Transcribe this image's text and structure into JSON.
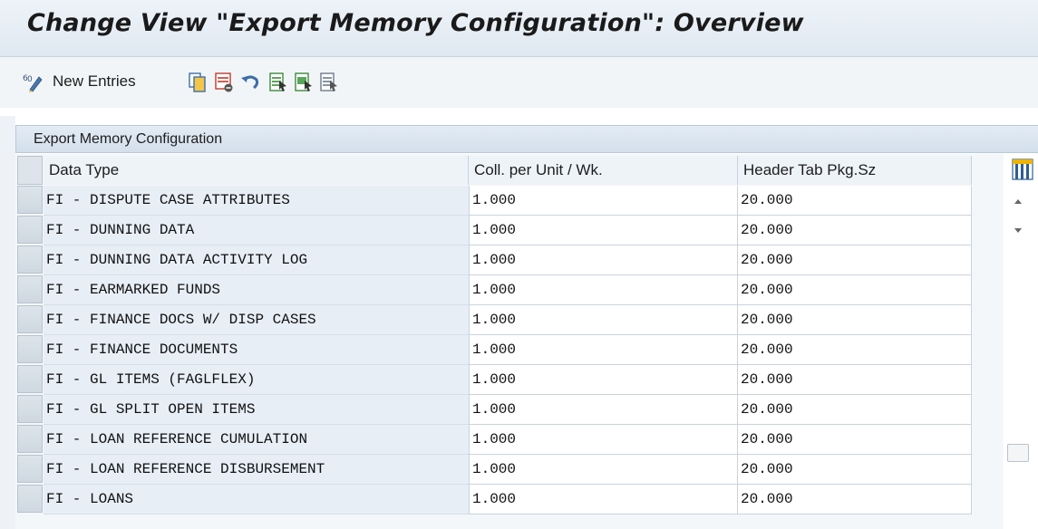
{
  "window": {
    "title": "Change View \"Export Memory Configuration\": Overview"
  },
  "toolbar": {
    "new_entries_label": "New Entries",
    "icons": [
      "display-change-icon",
      "copy-icon",
      "delete-icon",
      "undo-icon",
      "select-all-icon",
      "select-block-icon",
      "deselect-all-icon"
    ]
  },
  "panel": {
    "title": "Export Memory Configuration"
  },
  "table": {
    "columns": [
      "Data Type",
      "Coll. per Unit / Wk.",
      "Header Tab Pkg.Sz"
    ],
    "rows": [
      {
        "type": "FI - DISPUTE CASE ATTRIBUTES",
        "coll": "1.000",
        "head": "20.000"
      },
      {
        "type": "FI - DUNNING DATA",
        "coll": "1.000",
        "head": "20.000"
      },
      {
        "type": "FI - DUNNING DATA ACTIVITY LOG",
        "coll": "1.000",
        "head": "20.000"
      },
      {
        "type": "FI - EARMARKED FUNDS",
        "coll": "1.000",
        "head": "20.000"
      },
      {
        "type": "FI - FINANCE DOCS W/ DISP CASES",
        "coll": "1.000",
        "head": "20.000"
      },
      {
        "type": "FI - FINANCE DOCUMENTS",
        "coll": "1.000",
        "head": "20.000"
      },
      {
        "type": "FI - GL ITEMS (FAGLFLEX)",
        "coll": "1.000",
        "head": "20.000"
      },
      {
        "type": "FI - GL SPLIT OPEN ITEMS",
        "coll": "1.000",
        "head": "20.000"
      },
      {
        "type": "FI - LOAN REFERENCE CUMULATION",
        "coll": "1.000",
        "head": "20.000"
      },
      {
        "type": "FI - LOAN REFERENCE DISBURSEMENT",
        "coll": "1.000",
        "head": "20.000"
      },
      {
        "type": "FI - LOANS",
        "coll": "1.000",
        "head": "20.000"
      }
    ]
  },
  "colors": {
    "title_bg": "#e6edf4",
    "header_bg": "#dbe5ef",
    "key_column_bg": "#e7eef6"
  }
}
